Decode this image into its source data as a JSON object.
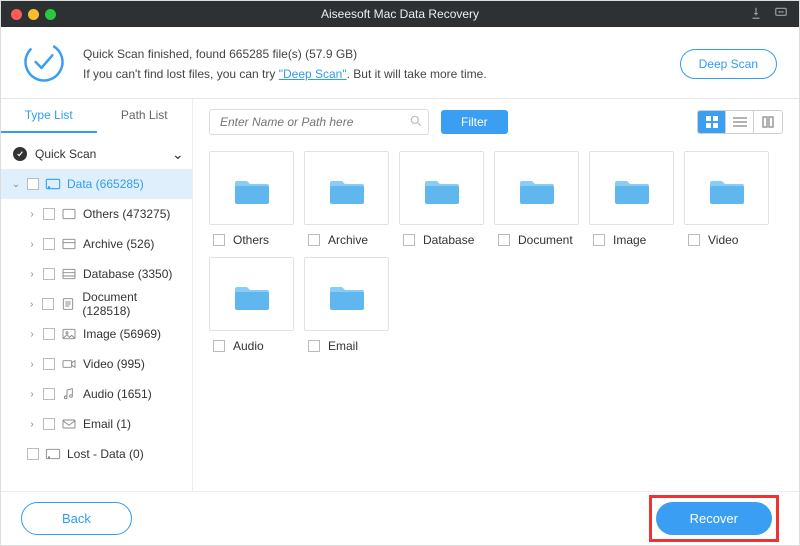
{
  "window": {
    "title": "Aiseesoft Mac Data Recovery"
  },
  "header": {
    "status_prefix": "Quick Scan finished, found ",
    "file_count": "665285",
    "status_mid": " file(s) ",
    "total_size": "(57.9 GB)",
    "hint_prefix": "If you can't find lost files, you can try ",
    "deep_scan_link": "\"Deep Scan\"",
    "hint_suffix": ". But it will take more time.",
    "deep_scan_button": "Deep Scan"
  },
  "sidebar": {
    "tabs": {
      "type_list": "Type List",
      "path_list": "Path List"
    },
    "root": {
      "label": "Quick Scan"
    },
    "data_node": "Data (665285)",
    "items": [
      {
        "label": "Others (473275)"
      },
      {
        "label": "Archive (526)"
      },
      {
        "label": "Database (3350)"
      },
      {
        "label": "Document (128518)"
      },
      {
        "label": "Image (56969)"
      },
      {
        "label": "Video (995)"
      },
      {
        "label": "Audio (1651)"
      },
      {
        "label": "Email (1)"
      }
    ],
    "lost_node": "Lost - Data (0)"
  },
  "toolbar": {
    "search_placeholder": "Enter Name or Path here",
    "filter_label": "Filter"
  },
  "grid": {
    "items": [
      {
        "label": "Others"
      },
      {
        "label": "Archive"
      },
      {
        "label": "Database"
      },
      {
        "label": "Document"
      },
      {
        "label": "Image"
      },
      {
        "label": "Video"
      },
      {
        "label": "Audio"
      },
      {
        "label": "Email"
      }
    ]
  },
  "footer": {
    "back_label": "Back",
    "recover_label": "Recover"
  }
}
